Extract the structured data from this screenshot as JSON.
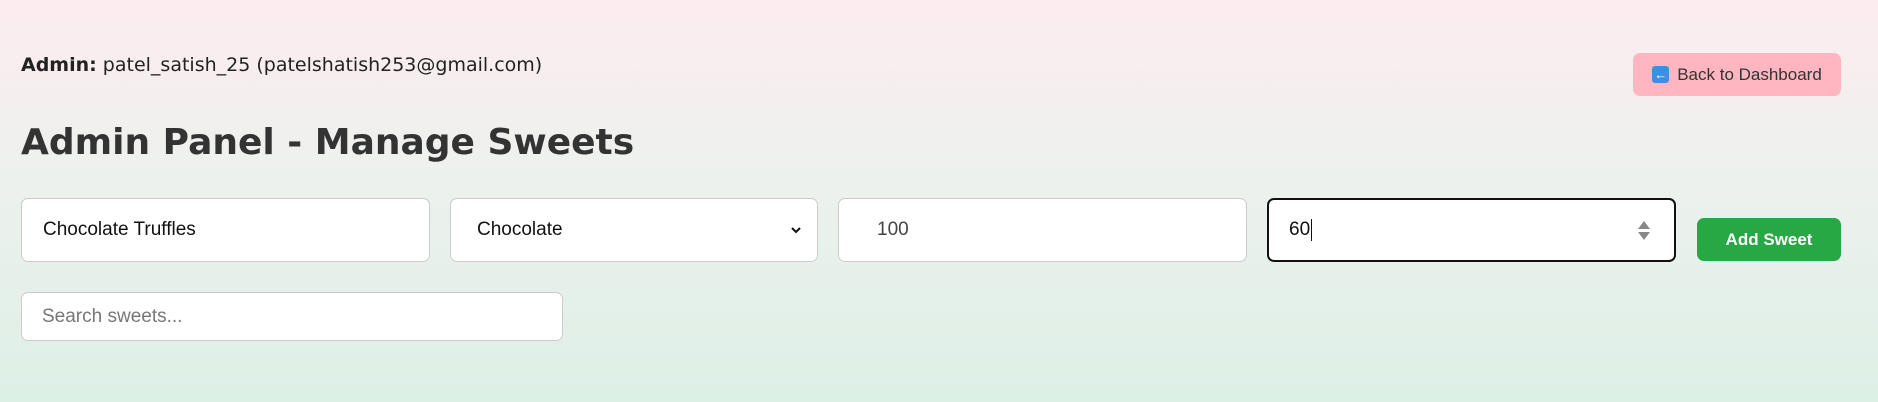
{
  "header": {
    "admin_label": "Admin:",
    "admin_user": "patel_satish_25 (patelshatish253@gmail.com)",
    "back_button_label": "Back to Dashboard",
    "back_button_icon": "left-arrow-icon"
  },
  "page": {
    "title": "Admin Panel - Manage Sweets"
  },
  "form": {
    "name_value": "Chocolate Truffles",
    "category_value": "Chocolate",
    "price_value": "100",
    "quantity_value": "60",
    "add_button_label": "Add Sweet"
  },
  "search": {
    "placeholder": "Search sweets..."
  },
  "colors": {
    "back_button_bg": "#ffb6c1",
    "add_button_bg": "#28a745",
    "icon_blue": "#3d8fe0"
  }
}
